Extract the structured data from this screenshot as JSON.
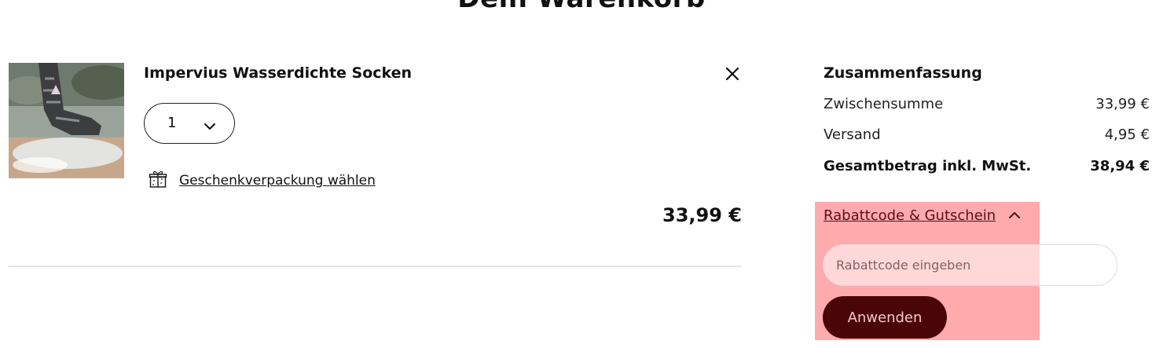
{
  "page": {
    "title": "Dein Warenkorb"
  },
  "cart": {
    "item": {
      "name": "Impervius Wasserdichte Socken",
      "quantity": "1",
      "gift_wrap_label": "Geschenkverpackung wählen",
      "price": "33,99 €",
      "image_icon": "waterproof-sock-photo"
    }
  },
  "summary": {
    "heading": "Zusammenfassung",
    "rows": [
      {
        "label": "Zwischensumme",
        "value": "33,99 €"
      },
      {
        "label": "Versand",
        "value": "4,95 €"
      }
    ],
    "total": {
      "label": "Gesamtbetrag inkl. MwSt.",
      "value": "38,94 €"
    }
  },
  "coupon": {
    "toggle_label": "Rabattcode & Gutschein",
    "input_placeholder": "Rabattcode eingeben",
    "input_value": "",
    "apply_label": "Anwenden",
    "highlight_color": "#ffabad",
    "button_color": "#4a0509"
  }
}
